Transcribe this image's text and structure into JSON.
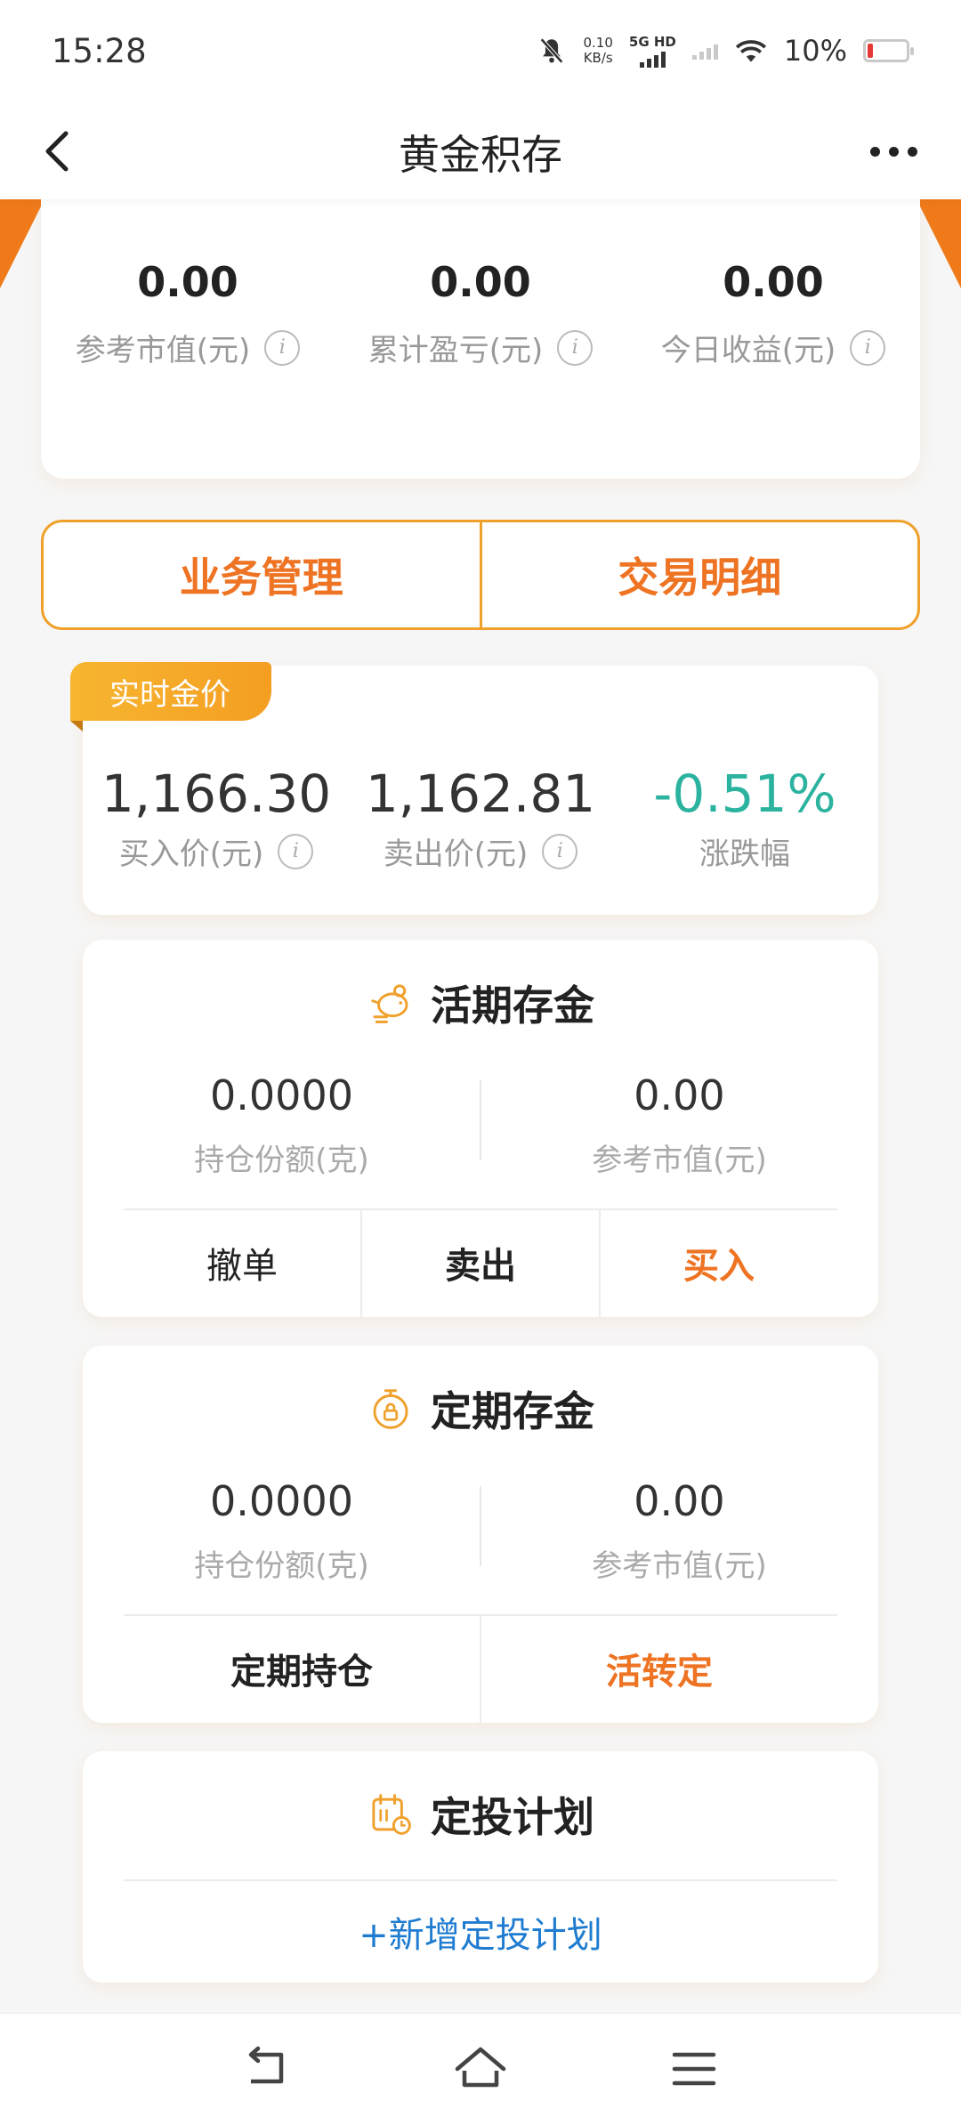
{
  "status": {
    "time": "15:28",
    "net_speed_value": "0.10",
    "net_speed_unit": "KB/s",
    "network": "5G HD",
    "battery": "10%"
  },
  "nav": {
    "title": "黄金积存"
  },
  "summary": {
    "items": [
      {
        "value": "0.00",
        "label": "参考市值(元)"
      },
      {
        "value": "0.00",
        "label": "累计盈亏(元)"
      },
      {
        "value": "0.00",
        "label": "今日收益(元)"
      }
    ]
  },
  "tabs": [
    {
      "label": "业务管理"
    },
    {
      "label": "交易明细"
    }
  ],
  "realtime": {
    "tag": "实时金价",
    "buy_price": "1,166.30",
    "buy_label": "买入价(元)",
    "sell_price": "1,162.81",
    "sell_label": "卖出价(元)",
    "change": "-0.51%",
    "change_label": "涨跌幅",
    "change_color": "#2bb3a0"
  },
  "current": {
    "title": "活期存金",
    "holding_value": "0.0000",
    "holding_label": "持仓份额(克)",
    "market_value": "0.00",
    "market_label": "参考市值(元)",
    "actions": {
      "cancel": "撤单",
      "sell": "卖出",
      "buy": "买入"
    }
  },
  "fixed": {
    "title": "定期存金",
    "holding_value": "0.0000",
    "holding_label": "持仓份额(克)",
    "market_value": "0.00",
    "market_label": "参考市值(元)",
    "actions": {
      "positions": "定期持仓",
      "convert": "活转定"
    }
  },
  "plan": {
    "title": "定投计划",
    "add": "+新增定投计划"
  },
  "colors": {
    "accent": "#ee7322",
    "gold": "#f0a12c",
    "link": "#1f7cd0"
  }
}
